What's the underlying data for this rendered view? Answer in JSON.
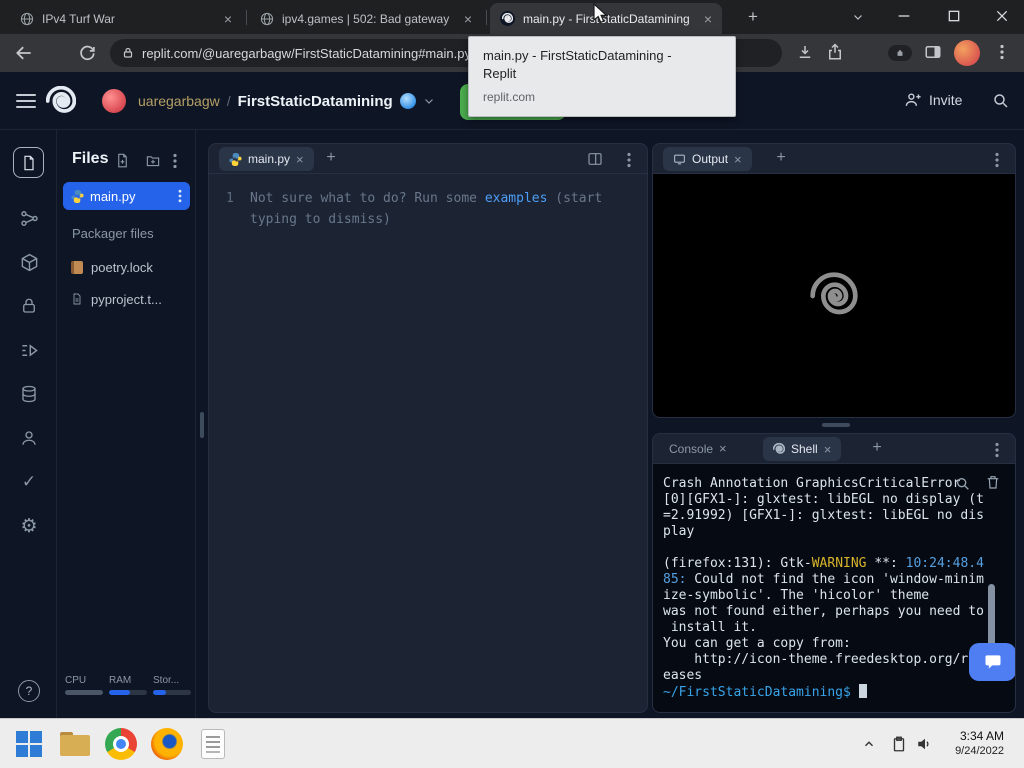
{
  "glyphs": {
    "plus": "+",
    "close": "×",
    "help": "?"
  },
  "icons": {
    "gear": "⚙",
    "check": "✓"
  },
  "browser": {
    "tabs": [
      {
        "title": "IPv4 Turf War"
      },
      {
        "title": "ipv4.games | 502: Bad gateway"
      },
      {
        "title": "main.py - FirstStaticDatamining"
      }
    ],
    "url": "replit.com/@uaregarbagw/FirstStaticDatamining#main.py",
    "tooltip": {
      "line1": "main.py - FirstStaticDatamining -",
      "line2": "Replit",
      "domain": "replit.com"
    }
  },
  "replit": {
    "header": {
      "username": "uaregarbagw",
      "separator": "/",
      "project": "FirstStaticDatamining",
      "invite_label": "Invite"
    },
    "files": {
      "title": "Files",
      "selected_file": "main.py",
      "section_label": "Packager files",
      "items": [
        "poetry.lock",
        "pyproject.t..."
      ],
      "meters": [
        {
          "label": "CPU",
          "pct": 100,
          "color": "#4a5565"
        },
        {
          "label": "RAM",
          "pct": 55,
          "color": "#2563eb"
        },
        {
          "label": "Stor...",
          "pct": 33,
          "color": "#2563eb"
        }
      ]
    },
    "editor": {
      "tab_label": "main.py",
      "line_number": "1",
      "ghost_prefix": "Not sure what to do? Run some ",
      "ghost_link": "examples",
      "ghost_suffix": " (start",
      "ghost_line2": "typing to dismiss)"
    },
    "output": {
      "tab_label": "Output"
    },
    "console": {
      "tab_console": "Console",
      "tab_shell": "Shell",
      "terminal": [
        [
          {
            "t": "Crash Annotation GraphicsCriticalError"
          }
        ],
        [
          {
            "t": "[0][GFX1-]: glxtest: libEGL no display (t"
          }
        ],
        [
          {
            "t": "=2.91992) [GFX1-]: glxtest: libEGL no dis"
          }
        ],
        [
          {
            "t": "play"
          }
        ],
        [],
        [
          {
            "t": "(firefox:131): Gtk-"
          },
          {
            "t": "WARNING",
            "c": "warn"
          },
          {
            "t": " **: "
          },
          {
            "t": "10:24:48.4",
            "c": "num"
          }
        ],
        [
          {
            "t": "85:",
            "c": "num"
          },
          {
            "t": " Could not find the icon 'window-minim"
          }
        ],
        [
          {
            "t": "ize-symbolic'. The 'hicolor' theme"
          }
        ],
        [
          {
            "t": "was not found either, perhaps you need to"
          }
        ],
        [
          {
            "t": " install it."
          }
        ],
        [
          {
            "t": "You can get a copy from:"
          }
        ],
        [
          {
            "t": "    http://icon-theme.freedesktop.org/rel"
          }
        ],
        [
          {
            "t": "eases"
          }
        ],
        [
          {
            "t": "~/FirstStaticDatamining$ ",
            "c": "prompt"
          }
        ]
      ]
    }
  },
  "taskbar": {
    "clock_time": "3:34 AM",
    "clock_date": "9/24/2022"
  }
}
